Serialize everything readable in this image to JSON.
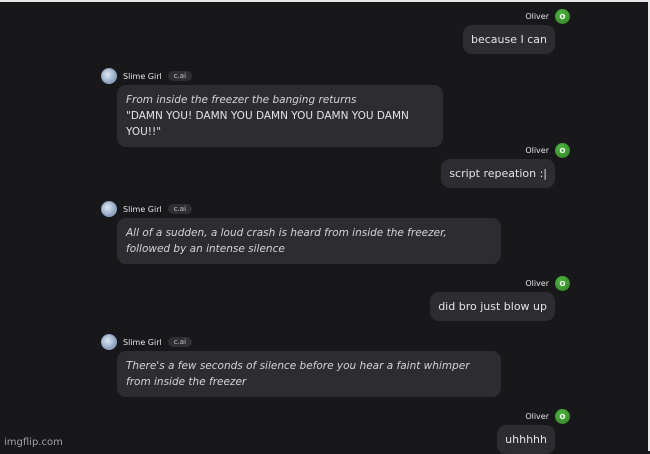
{
  "user": {
    "name": "Oliver",
    "avatar_letter": "O"
  },
  "bot": {
    "name": "Slime Girl",
    "badge": "c.ai"
  },
  "messages": {
    "m1": {
      "text": "because I can"
    },
    "m2": {
      "line1": "From inside the freezer the banging returns",
      "line2": "\"DAMN YOU! DAMN YOU DAMN YOU DAMN YOU DAMN YOU!!\""
    },
    "m3": {
      "text": "script repeation :|"
    },
    "m4": {
      "text": "All of a sudden, a loud crash is heard from inside the freezer, followed by an intense silence"
    },
    "m5": {
      "text": "did bro just blow up"
    },
    "m6": {
      "text": "There's a few seconds of silence before you hear a faint whimper from inside the freezer"
    },
    "m7": {
      "text": "uhhhhh"
    }
  },
  "watermark": "imgflip.com"
}
